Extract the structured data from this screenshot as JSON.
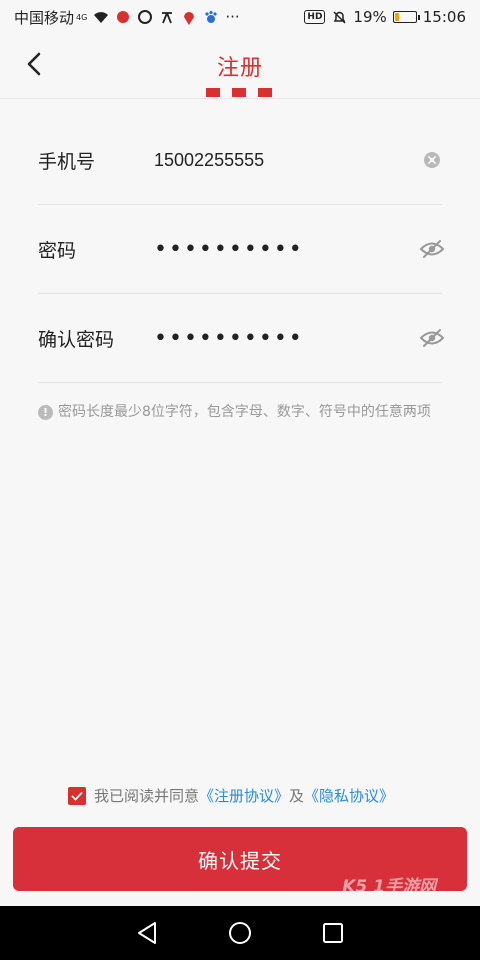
{
  "status_bar": {
    "carrier": "中国移动",
    "network": "4G",
    "battery": "19%",
    "battery_level": 0.19,
    "time": "15:06",
    "hd": "HD",
    "more": "···"
  },
  "header": {
    "title": "注册"
  },
  "form": {
    "phone_label": "手机号",
    "phone_value": "15002255555",
    "password_label": "密码",
    "password_value": "••••••••••",
    "confirm_label": "确认密码",
    "confirm_value": "••••••••••"
  },
  "hint": {
    "text": "密码长度最少8位字符，包含字母、数字、符号中的任意两项"
  },
  "agreement": {
    "prefix": "我已阅读并同意",
    "register_link": "《注册协议》",
    "and": "及",
    "privacy_link": "《隐私协议》",
    "checked": true
  },
  "submit": {
    "label": "确认提交"
  },
  "watermark": {
    "text": "K5 1手游网"
  },
  "colors": {
    "accent": "#d8302f",
    "link": "#2a8bd8",
    "button": "#d8303a"
  }
}
